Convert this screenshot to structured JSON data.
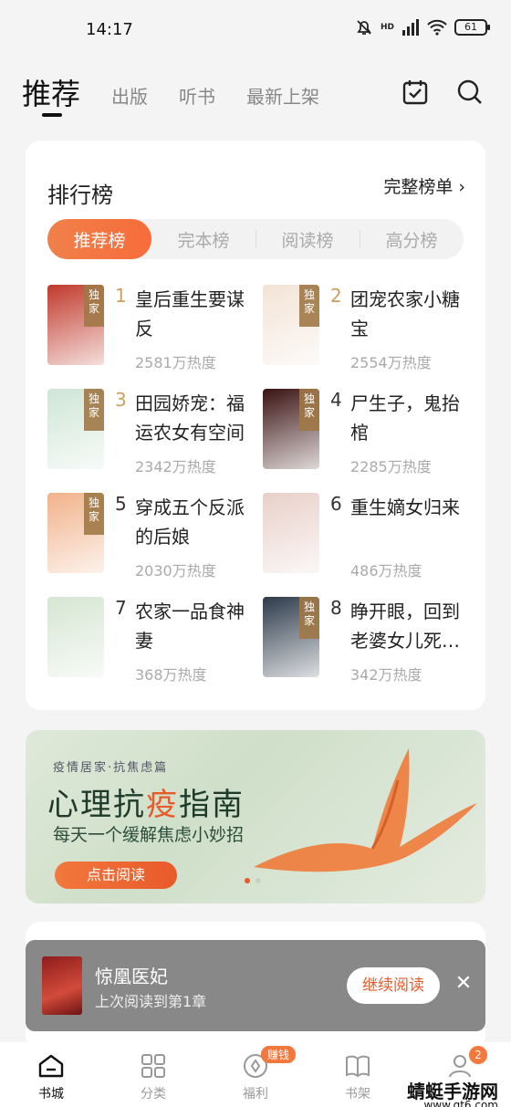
{
  "status": {
    "time": "14:17",
    "battery": "61",
    "network": "HD"
  },
  "top_nav": {
    "tabs": [
      "推荐",
      "出版",
      "听书",
      "最新上架"
    ],
    "active": 0
  },
  "ranking": {
    "title": "排行榜",
    "full_link": "完整榜单",
    "tabs": [
      "推荐榜",
      "完本榜",
      "阅读榜",
      "高分榜"
    ],
    "exclusive_label": "独家",
    "books": [
      {
        "rank": "1",
        "title": "皇后重生要谋反",
        "heat": "2581万热度",
        "exclusive": true,
        "cover_color": "#c0392b"
      },
      {
        "rank": "2",
        "title": "团宠农家小糖宝",
        "heat": "2554万热度",
        "exclusive": true,
        "cover_color": "#f3e3d6"
      },
      {
        "rank": "3",
        "title": "田园娇宠：福运农女有空间",
        "heat": "2342万热度",
        "exclusive": true,
        "cover_color": "#cfe6d6"
      },
      {
        "rank": "4",
        "title": "尸生子，鬼抬棺",
        "heat": "2285万热度",
        "exclusive": true,
        "cover_color": "#3a1212"
      },
      {
        "rank": "5",
        "title": "穿成五个反派的后娘",
        "heat": "2030万热度",
        "exclusive": true,
        "cover_color": "#f1b28a"
      },
      {
        "rank": "6",
        "title": "重生嫡女归来",
        "heat": "486万热度",
        "exclusive": false,
        "cover_color": "#e8d0c9"
      },
      {
        "rank": "7",
        "title": "农家一品食神妻",
        "heat": "368万热度",
        "exclusive": false,
        "cover_color": "#d5e6d2"
      },
      {
        "rank": "8",
        "title": "睁开眼，回到老婆女儿死…",
        "heat": "342万热度",
        "exclusive": true,
        "cover_color": "#2d3a4a"
      }
    ]
  },
  "banner": {
    "subtitle": "疫情居家·抗焦虑篇",
    "title_a": "心理抗",
    "title_hl": "疫",
    "title_b": "指南",
    "slogan": "每天一个缓解焦虑小妙招",
    "cta": "点击阅读"
  },
  "continue": {
    "title": "惊凰医妃",
    "subtitle": "上次阅读到第1章",
    "button": "继续阅读"
  },
  "bottom_nav": {
    "items": [
      "书城",
      "分类",
      "福利",
      "书架",
      "我的"
    ],
    "earn_badge": "赚钱",
    "count_badge": "2"
  },
  "watermark": {
    "main": "蜻蜓手游网",
    "url": "www.qt6.com"
  }
}
